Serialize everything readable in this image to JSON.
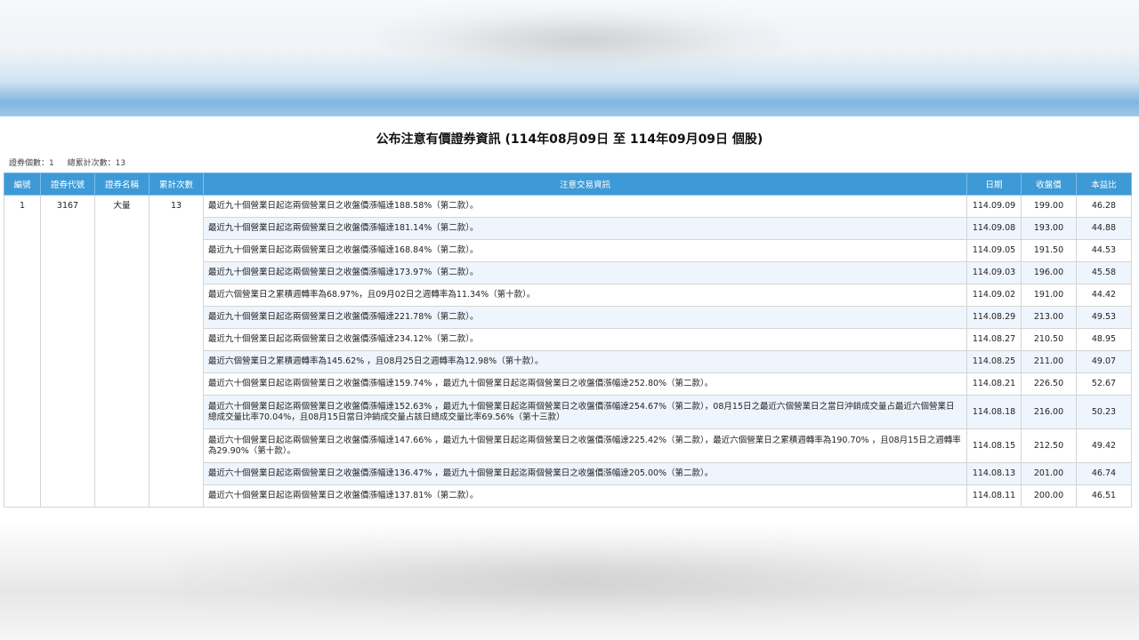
{
  "page": {
    "title": "公布注意有價證券資訊 (114年08月09日 至 114年09月09日 個股)",
    "summary_count": "證券個數：1",
    "summary_total": "總累計次數：13"
  },
  "table": {
    "headers": {
      "no": "編號",
      "code": "證券代號",
      "name": "證券名稱",
      "cumulative": "累計次數",
      "info": "注意交易資訊",
      "date": "日期",
      "close": "收盤價",
      "pe": "本益比"
    },
    "security": {
      "no": "1",
      "code": "3167",
      "name": "大量",
      "cumulative": "13"
    },
    "rows": [
      {
        "info": "最近九十個營業日起迄兩個營業日之收盤價漲幅達188.58%（第二款）。",
        "date": "114.09.09",
        "close": "199.00",
        "pe": "46.28"
      },
      {
        "info": "最近九十個營業日起迄兩個營業日之收盤價漲幅達181.14%（第二款）。",
        "date": "114.09.08",
        "close": "193.00",
        "pe": "44.88"
      },
      {
        "info": "最近九十個營業日起迄兩個營業日之收盤價漲幅達168.84%（第二款）。",
        "date": "114.09.05",
        "close": "191.50",
        "pe": "44.53"
      },
      {
        "info": "最近九十個營業日起迄兩個營業日之收盤價漲幅達173.97%（第二款）。",
        "date": "114.09.03",
        "close": "196.00",
        "pe": "45.58"
      },
      {
        "info": "最近六個營業日之累積週轉率為68.97%，且09月02日之週轉率為11.34%（第十款）。",
        "date": "114.09.02",
        "close": "191.00",
        "pe": "44.42"
      },
      {
        "info": "最近九十個營業日起迄兩個營業日之收盤價漲幅達221.78%（第二款）。",
        "date": "114.08.29",
        "close": "213.00",
        "pe": "49.53"
      },
      {
        "info": "最近九十個營業日起迄兩個營業日之收盤價漲幅達234.12%（第二款）。",
        "date": "114.08.27",
        "close": "210.50",
        "pe": "48.95"
      },
      {
        "info": "最近六個營業日之累積週轉率為145.62% ，且08月25日之週轉率為12.98%（第十款）。",
        "date": "114.08.25",
        "close": "211.00",
        "pe": "49.07"
      },
      {
        "info": "最近六十個營業日起迄兩個營業日之收盤價漲幅達159.74% ，最近九十個營業日起迄兩個營業日之收盤價漲幅達252.80%（第二款）。",
        "date": "114.08.21",
        "close": "226.50",
        "pe": "52.67"
      },
      {
        "info": "最近六十個營業日起迄兩個營業日之收盤價漲幅達152.63% ，最近九十個營業日起迄兩個營業日之收盤價漲幅達254.67%（第二款），08月15日之最近六個營業日之當日沖銷成交量占最近六個營業日總成交量比率70.04%，且08月15日當日沖銷成交量占該日總成交量比率69.56%（第十三款）",
        "date": "114.08.18",
        "close": "216.00",
        "pe": "50.23"
      },
      {
        "info": "最近六十個營業日起迄兩個營業日之收盤價漲幅達147.66% ，最近九十個營業日起迄兩個營業日之收盤價漲幅達225.42%（第二款），最近六個營業日之累積週轉率為190.70% ，且08月15日之週轉率為29.90%（第十款）。",
        "date": "114.08.15",
        "close": "212.50",
        "pe": "49.42"
      },
      {
        "info": "最近六十個營業日起迄兩個營業日之收盤價漲幅達136.47% ，最近九十個營業日起迄兩個營業日之收盤價漲幅達205.00%（第二款）。",
        "date": "114.08.13",
        "close": "201.00",
        "pe": "46.74"
      },
      {
        "info": "最近六十個營業日起迄兩個營業日之收盤價漲幅達137.81%（第二款）。",
        "date": "114.08.11",
        "close": "200.00",
        "pe": "46.51"
      }
    ]
  },
  "colors": {
    "header_bg": "#3d9ad6",
    "alt_row_bg": "#eef5fd"
  }
}
